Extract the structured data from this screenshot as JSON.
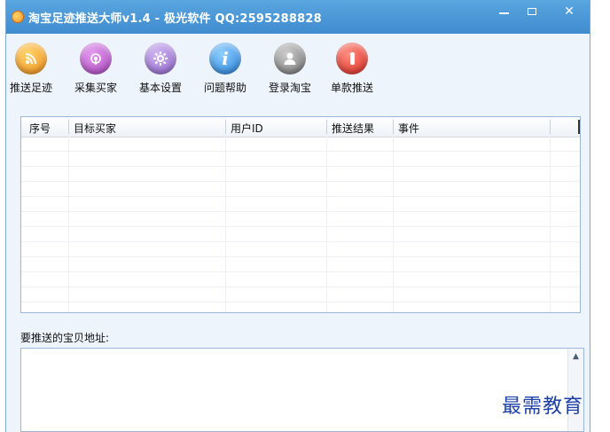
{
  "window": {
    "title": "淘宝足迹推送大师v1.4 - 极光软件 QQ:2595288828"
  },
  "toolbar": {
    "items": [
      {
        "label": "推送足迹",
        "icon": "rss-icon",
        "color": "#f5a623"
      },
      {
        "label": "采集买家",
        "icon": "broadcast-icon",
        "color": "#b04fc4"
      },
      {
        "label": "基本设置",
        "icon": "gear-icon",
        "color": "#9a6fd0"
      },
      {
        "label": "问题帮助",
        "icon": "info-icon",
        "color": "#2f8de4"
      },
      {
        "label": "登录淘宝",
        "icon": "user-icon",
        "color": "#7d7d7d"
      },
      {
        "label": "单款推送",
        "icon": "stop-icon",
        "color": "#e0342a"
      }
    ]
  },
  "table": {
    "columns": [
      "序号",
      "目标买家",
      "用户ID",
      "推送结果",
      "事件"
    ]
  },
  "address": {
    "label": "要推送的宝贝地址:",
    "value": ""
  },
  "watermark": "最需教育"
}
